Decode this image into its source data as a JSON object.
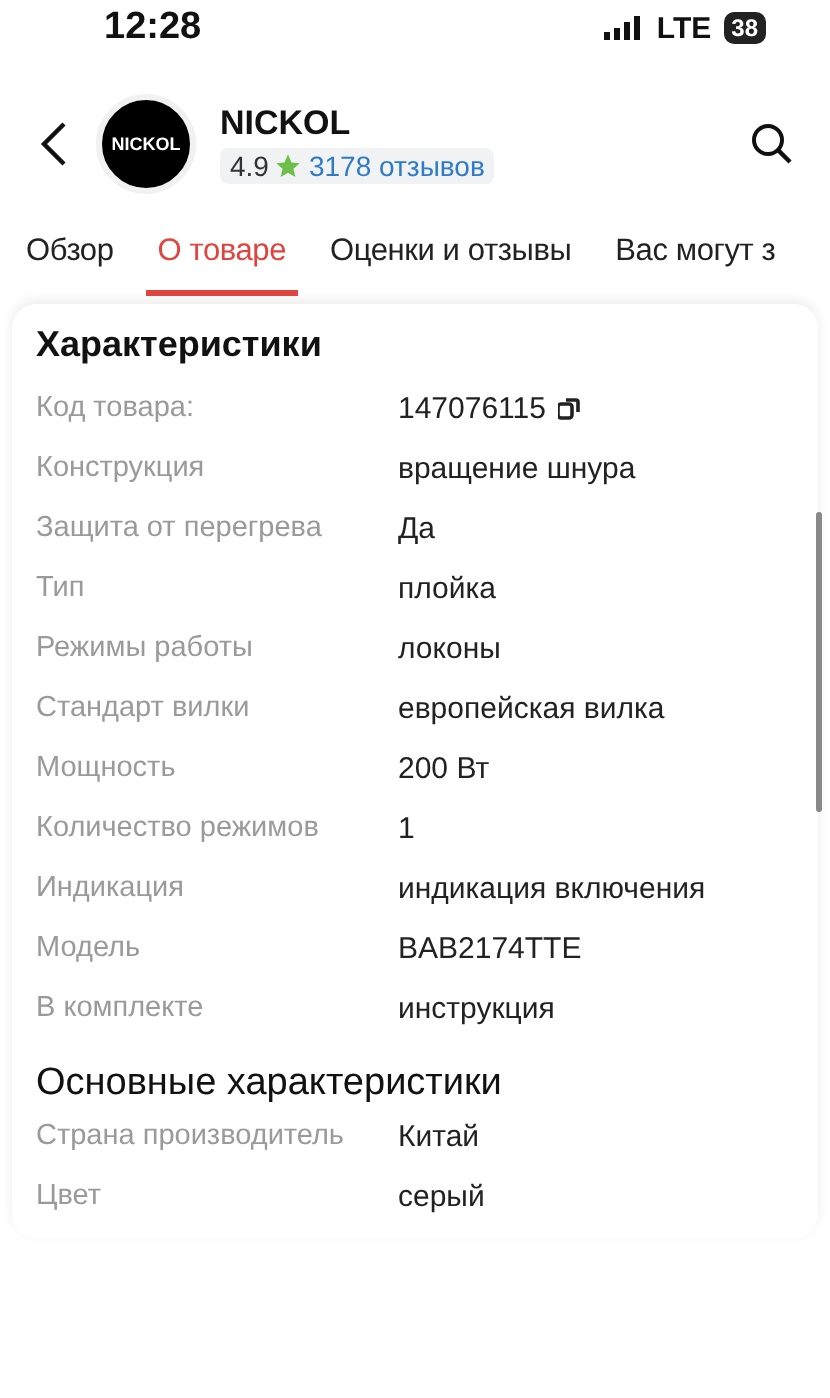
{
  "status_bar": {
    "time": "12:28",
    "network": "LTE",
    "battery": "38"
  },
  "header": {
    "logo": "NICKOL",
    "title": "NICKOL",
    "rating": "4.9",
    "reviews": "3178 отзывов"
  },
  "tabs": [
    {
      "label": "Обзор",
      "selected": false
    },
    {
      "label": "О товаре",
      "selected": true
    },
    {
      "label": "Оценки и отзывы",
      "selected": false
    },
    {
      "label": "Вас могут з",
      "selected": false
    }
  ],
  "sections": [
    {
      "title": "Характеристики",
      "kind": "bold",
      "rows": [
        {
          "label": "Код товара:",
          "value": "147076115",
          "copyable": true
        },
        {
          "label": "Конструкция",
          "value": "вращение шнура"
        },
        {
          "label": "Защита от перегрева",
          "value": "Да"
        },
        {
          "label": "Тип",
          "value": "плойка"
        },
        {
          "label": "Режимы работы",
          "value": "локоны"
        },
        {
          "label": "Стандарт вилки",
          "value": "европейская вилка"
        },
        {
          "label": "Мощность",
          "value": "200 Вт"
        },
        {
          "label": "Количество режимов",
          "value": "1"
        },
        {
          "label": "Индикация",
          "value": "индикация включения"
        },
        {
          "label": "Модель",
          "value": "BAB2174TTE"
        },
        {
          "label": "В комплекте",
          "value": "инструкция"
        }
      ]
    },
    {
      "title": "Основные характеристики",
      "kind": "regular",
      "rows": [
        {
          "label": "Страна производитель",
          "value": "Китай"
        },
        {
          "label": "Цвет",
          "value": "серый"
        }
      ]
    }
  ]
}
